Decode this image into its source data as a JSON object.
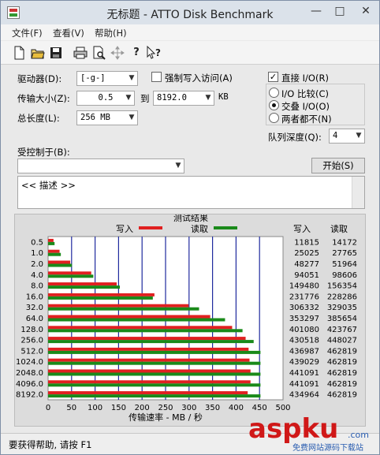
{
  "window": {
    "title": "无标题 - ATTO Disk Benchmark"
  },
  "menu": [
    "文件(F)",
    "查看(V)",
    "帮助(H)"
  ],
  "toolbar_icons": [
    "new-icon",
    "open-icon",
    "save-icon",
    "print-icon",
    "print-preview-icon",
    "move-icon",
    "help-icon",
    "context-help-icon"
  ],
  "settings": {
    "drive_label": "驱动器(D):",
    "drive_value": "[-g-]",
    "force_write_label": "强制写入访问(A)",
    "force_write_checked": false,
    "transfer_label": "传输大小(Z):",
    "transfer_from": "0.5",
    "transfer_to_label": "到",
    "transfer_to": "8192.0",
    "transfer_unit": "KB",
    "total_label": "总长度(L):",
    "total_value": "256 MB",
    "direct_io_label": "直接 I/O(R)",
    "direct_io_checked": true,
    "io_options": [
      {
        "label": "I/O 比较(C)",
        "selected": false
      },
      {
        "label": "交叠 I/O(O)",
        "selected": true
      },
      {
        "label": "两者都不(N)",
        "selected": false
      }
    ],
    "queue_label": "队列深度(Q):",
    "queue_value": "4",
    "controlled_label": "受控制于(B):",
    "controlled_value": "",
    "start_button": "开始(S)",
    "description": "<< 描述 >>"
  },
  "results": {
    "title": "测试结果",
    "legend_write": "写入",
    "legend_read": "读取",
    "col_write": "写入",
    "col_read": "读取",
    "write_color": "#e02020",
    "read_color": "#1a8a1a",
    "rows": [
      {
        "size": "0.5",
        "write": "11815",
        "read": "14172"
      },
      {
        "size": "1.0",
        "write": "25025",
        "read": "27765"
      },
      {
        "size": "2.0",
        "write": "48277",
        "read": "51964"
      },
      {
        "size": "4.0",
        "write": "94051",
        "read": "98606"
      },
      {
        "size": "8.0",
        "write": "149480",
        "read": "156354"
      },
      {
        "size": "16.0",
        "write": "231776",
        "read": "228286"
      },
      {
        "size": "32.0",
        "write": "306332",
        "read": "329035"
      },
      {
        "size": "64.0",
        "write": "353297",
        "read": "385654"
      },
      {
        "size": "128.0",
        "write": "401080",
        "read": "423767"
      },
      {
        "size": "256.0",
        "write": "430518",
        "read": "448027"
      },
      {
        "size": "512.0",
        "write": "436987",
        "read": "462819"
      },
      {
        "size": "1024.0",
        "write": "439029",
        "read": "462819"
      },
      {
        "size": "2048.0",
        "write": "441091",
        "read": "462819"
      },
      {
        "size": "4096.0",
        "write": "441091",
        "read": "462819"
      },
      {
        "size": "8192.0",
        "write": "434964",
        "read": "462819"
      }
    ]
  },
  "chart_data": {
    "type": "bar",
    "orientation": "horizontal",
    "title": "测试结果",
    "xlabel": "传输速率 - MB / 秒",
    "ylabel": "",
    "xlim": [
      0,
      500
    ],
    "x_ticks": [
      "0",
      "50",
      "100",
      "150",
      "200",
      "250",
      "300",
      "350",
      "400",
      "450",
      "500"
    ],
    "categories": [
      "0.5",
      "1.0",
      "2.0",
      "4.0",
      "8.0",
      "16.0",
      "32.0",
      "64.0",
      "128.0",
      "256.0",
      "512.0",
      "1024.0",
      "2048.0",
      "4096.0",
      "8192.0"
    ],
    "series": [
      {
        "name": "写入",
        "color": "#e02020",
        "values": [
          11.5,
          24.4,
          47.1,
          91.8,
          146.0,
          226.3,
          299.2,
          345.0,
          391.7,
          420.4,
          426.7,
          428.7,
          430.8,
          430.8,
          424.8
        ]
      },
      {
        "name": "读取",
        "color": "#1a8a1a",
        "values": [
          13.8,
          27.1,
          50.7,
          96.3,
          152.7,
          222.9,
          321.3,
          376.6,
          413.8,
          437.5,
          452.0,
          452.0,
          452.0,
          452.0,
          452.0
        ]
      }
    ],
    "grid": true,
    "legend": "top"
  },
  "status": "要获得帮助, 请按 F1",
  "watermark": {
    "text": "aspku",
    "suffix": ".com",
    "subtext": "免费网站源码下载站"
  }
}
